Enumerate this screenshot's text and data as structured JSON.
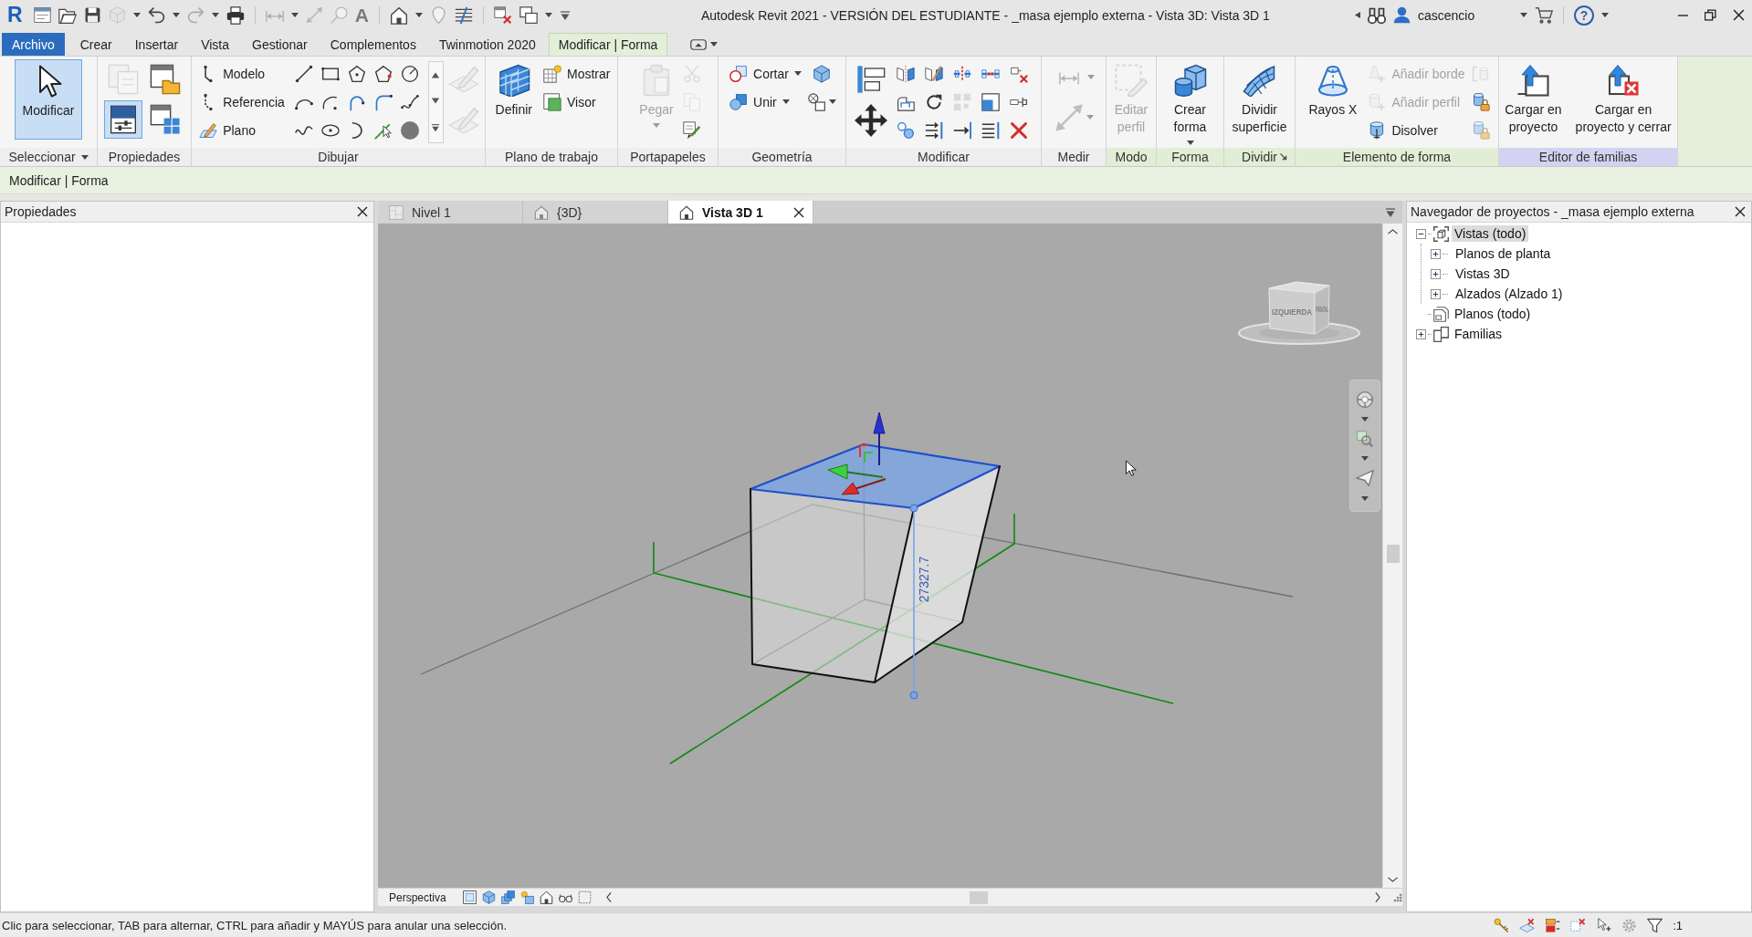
{
  "window": {
    "logo": "R",
    "title": "Autodesk Revit 2021 - VERSIÓN DEL ESTUDIANTE - _masa ejemplo externa - Vista 3D: Vista 3D 1",
    "user": "cascencio",
    "help": "?"
  },
  "quick_access": {
    "text_tool": "A"
  },
  "ribbon_tabs": [
    {
      "label": "Archivo",
      "kind": "file",
      "selected": false
    },
    {
      "label": "Crear",
      "kind": "tab",
      "selected": false
    },
    {
      "label": "Insertar",
      "kind": "tab",
      "selected": false
    },
    {
      "label": "Vista",
      "kind": "tab",
      "selected": false
    },
    {
      "label": "Gestionar",
      "kind": "tab",
      "selected": false
    },
    {
      "label": "Complementos",
      "kind": "tab",
      "selected": false
    },
    {
      "label": "Twinmotion 2020",
      "kind": "tab",
      "selected": false
    },
    {
      "label": "Modificar | Forma",
      "kind": "contextual",
      "selected": true
    }
  ],
  "ribbon_panels": [
    {
      "label": "Seleccionar",
      "kind": "select",
      "color": "#eeeeee",
      "menu": true,
      "tools": [
        {
          "label": "Modificar",
          "kind": "large",
          "active": true,
          "disabled": false,
          "menu": false
        }
      ]
    },
    {
      "label": "Propiedades",
      "kind": "properties",
      "color": "#eeeeee",
      "palette_on": true
    },
    {
      "label": "Dibujar",
      "kind": "draw",
      "color": "#eeeeee",
      "tools": [
        {
          "label": "Modelo",
          "kind": "small",
          "disabled": false,
          "menu": false
        },
        {
          "label": "Referencia",
          "kind": "small",
          "disabled": false,
          "menu": false
        },
        {
          "label": "Plano",
          "kind": "small",
          "disabled": false,
          "menu": false
        }
      ]
    },
    {
      "label": "Plano de trabajo",
      "kind": "workplane",
      "color": "#eeeeee",
      "tools": [
        {
          "label": "Definir",
          "kind": "large",
          "disabled": false,
          "menu": false
        },
        {
          "label": "Mostrar",
          "kind": "small",
          "disabled": false,
          "menu": false
        },
        {
          "label": "Visor",
          "kind": "small",
          "disabled": false,
          "menu": false
        }
      ]
    },
    {
      "label": "Portapapeles",
      "kind": "clipboard",
      "color": "#eeeeee",
      "tools": [
        {
          "label": "Pegar",
          "kind": "large",
          "disabled": true,
          "menu": true
        }
      ]
    },
    {
      "label": "Geometría",
      "kind": "geometry",
      "color": "#eeeeee",
      "tools": [
        {
          "label": "Cortar",
          "kind": "small",
          "disabled": false,
          "menu": true
        },
        {
          "label": "Unir",
          "kind": "small",
          "disabled": false,
          "menu": true
        }
      ]
    },
    {
      "label": "Modificar",
      "kind": "modify",
      "color": "#eeeeee"
    },
    {
      "label": "Medir",
      "kind": "measure",
      "color": "#eeeeee"
    },
    {
      "label": "Modo",
      "kind": "mode",
      "color": "#e1eed5",
      "tools": [
        {
          "label": "Editar\nperfil",
          "kind": "large",
          "disabled": true,
          "menu": false
        }
      ]
    },
    {
      "label": "Forma",
      "kind": "form",
      "color": "#e1eed5",
      "tools": [
        {
          "label": "Crear\nforma",
          "kind": "large",
          "disabled": false,
          "menu": true
        }
      ]
    },
    {
      "label": "Dividir",
      "kind": "divide",
      "color": "#e1eed5",
      "launcher": true,
      "tools": [
        {
          "label": "Dividir\nsuperficie",
          "kind": "large",
          "disabled": false,
          "menu": false
        }
      ]
    },
    {
      "label": "Elemento de forma",
      "kind": "form_element",
      "color": "#e1eed5",
      "tools": [
        {
          "label": "Rayos X",
          "kind": "large",
          "disabled": false,
          "menu": false
        },
        {
          "label": "Añadir borde",
          "kind": "small",
          "disabled": true,
          "menu": false
        },
        {
          "label": "Añadir perfil",
          "kind": "small",
          "disabled": true,
          "menu": false
        },
        {
          "label": "Disolver",
          "kind": "small",
          "disabled": false,
          "menu": false
        }
      ]
    },
    {
      "label": "Editor de familias",
      "kind": "family_editor",
      "color": "#d3d3f1",
      "tools": [
        {
          "label": "Cargar en\nproyecto",
          "kind": "large",
          "disabled": false,
          "menu": false
        },
        {
          "label": "Cargar en\nproyecto y cerrar",
          "kind": "large",
          "disabled": false,
          "menu": false
        }
      ]
    }
  ],
  "options_bar": {
    "label": "Modificar | Forma"
  },
  "properties_palette": {
    "title": "Propiedades"
  },
  "view_tabs": [
    {
      "label": "Nivel 1",
      "kind": "plan",
      "selected": false
    },
    {
      "label": "{3D}",
      "kind": "model",
      "selected": false
    },
    {
      "label": "Vista 3D 1",
      "kind": "model",
      "selected": true
    }
  ],
  "viewport": {
    "dimension": "27327.7",
    "view_cube": {
      "left_face": "IZQUIERDA",
      "front_face": "FRONTAL"
    },
    "view_control_bar": {
      "projection": "Perspectiva"
    }
  },
  "project_browser": {
    "title": "Navegador de proyectos - _masa ejemplo externa",
    "tree": [
      {
        "label": "Vistas (todo)",
        "kind": "views",
        "selected": true,
        "expanded": true,
        "children": [
          {
            "label": "Planos de planta",
            "selected": false,
            "expanded": false
          },
          {
            "label": "Vistas 3D",
            "selected": false,
            "expanded": false
          },
          {
            "label": "Alzados (Alzado 1)",
            "selected": false,
            "expanded": false
          }
        ]
      },
      {
        "label": "Planos (todo)",
        "kind": "sheets",
        "selected": false
      },
      {
        "label": "Familias",
        "kind": "families",
        "selected": false,
        "expanded": false
      }
    ]
  },
  "status_bar": {
    "message": "Clic para seleccionar, TAB para alternar, CTRL para añadir y MAYÚS para anular una selección.",
    "filter_count": ":1"
  }
}
